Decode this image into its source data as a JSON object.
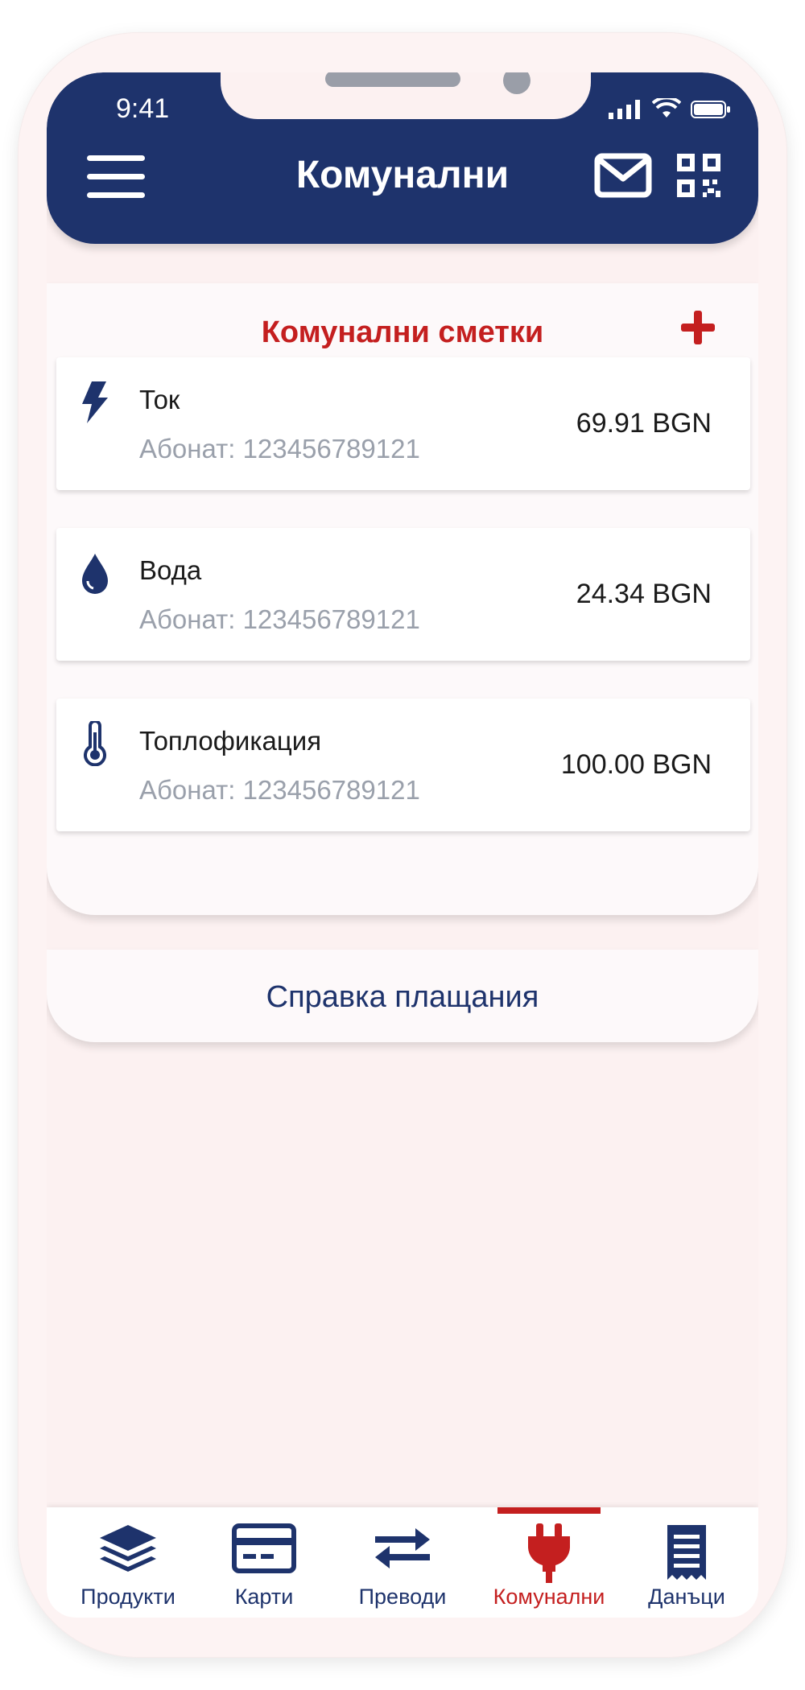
{
  "status_bar": {
    "time": "9:41"
  },
  "header": {
    "title": "Комунални"
  },
  "bills": {
    "title": "Комунални сметки",
    "items": [
      {
        "name": "Ток",
        "subscriber": "Абонат: 123456789121",
        "amount": "69.91 BGN",
        "icon": "lightning-icon"
      },
      {
        "name": "Вода",
        "subscriber": "Абонат: 123456789121",
        "amount": "24.34 BGN",
        "icon": "water-drop-icon"
      },
      {
        "name": "Топлофикация",
        "subscriber": "Абонат: 123456789121",
        "amount": "100.00 BGN",
        "icon": "thermometer-icon"
      }
    ]
  },
  "report_button": {
    "label": "Справка плащания"
  },
  "bottom_nav": {
    "items": [
      {
        "label": "Продукти",
        "icon": "layers-icon"
      },
      {
        "label": "Карти",
        "icon": "card-icon"
      },
      {
        "label": "Преводи",
        "icon": "transfer-icon"
      },
      {
        "label": "Комунални",
        "icon": "plug-icon",
        "active": true
      },
      {
        "label": "Данъци",
        "icon": "receipt-icon"
      }
    ]
  },
  "colors": {
    "brand": "#1e336c",
    "accent": "#c41f1f",
    "background": "#fcf1f1"
  }
}
